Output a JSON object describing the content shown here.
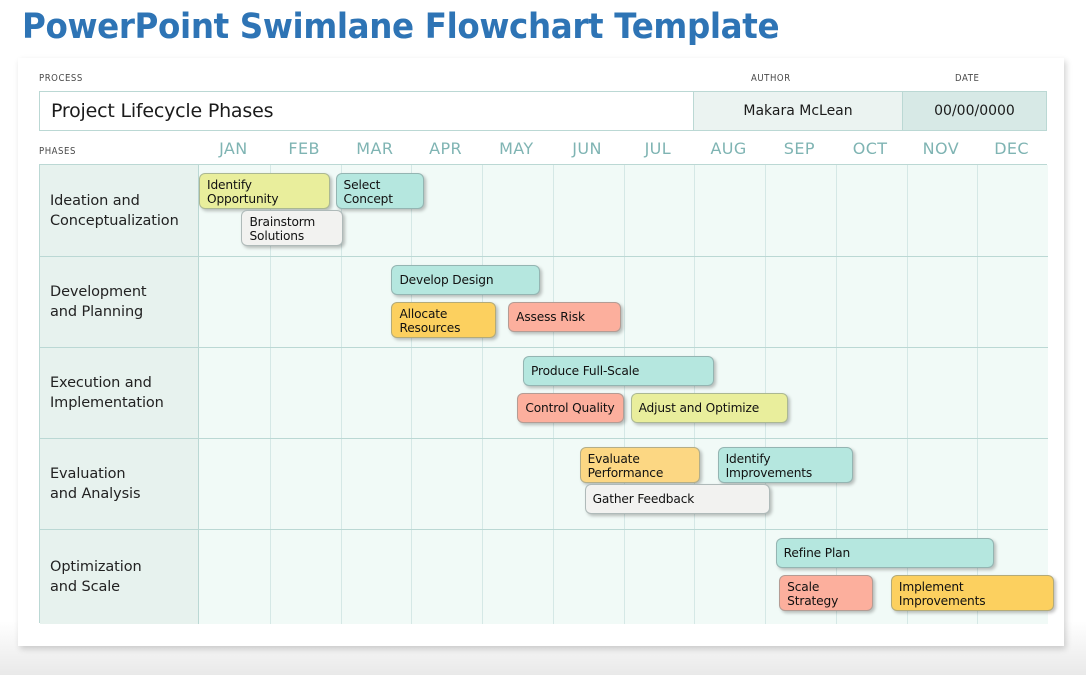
{
  "title": "PowerPoint Swimlane Flowchart Template",
  "header": {
    "process_label": "PROCESS",
    "author_label": "AUTHOR",
    "date_label": "DATE",
    "process_value": "Project Lifecycle Phases",
    "author_value": "Makara McLean",
    "date_value": "00/00/0000"
  },
  "timeline": {
    "phases_caption": "PHASES",
    "months": [
      "JAN",
      "FEB",
      "MAR",
      "APR",
      "MAY",
      "JUN",
      "JUL",
      "AUG",
      "SEP",
      "OCT",
      "NOV",
      "DEC"
    ]
  },
  "colors": {
    "title": "#2E74B5",
    "grid_line": "#BBD8D4",
    "lane_name_bg": "#E7F2EE",
    "track_bg": "#F1FAF7",
    "month_text": "#7FB4B3",
    "date_cell_bg": "#D7E9E6",
    "author_cell_bg": "#EBF3F1",
    "task_yellow": "#E9EE9C",
    "task_teal": "#B5E7DF",
    "task_white": "#F2F2F0",
    "task_amber": "#FCD05F",
    "task_amber_light": "#FCD783",
    "task_salmon": "#FCAF9D"
  },
  "lanes": [
    {
      "name": "Ideation and\nConceptualization",
      "tasks": [
        {
          "label": "Identify\nOpportunity",
          "color": "#E9EE9C",
          "start": 0.0,
          "span": 1.85,
          "row": 0,
          "align": "top"
        },
        {
          "label": "Select\nConcept",
          "color": "#B5E7DF",
          "start": 1.93,
          "span": 1.25,
          "row": 0,
          "align": "top"
        },
        {
          "label": "Brainstorm\nSolutions",
          "color": "#F2F2F0",
          "start": 0.6,
          "span": 1.43,
          "row": 1,
          "align": "top"
        }
      ]
    },
    {
      "name": "Development\nand Planning",
      "tasks": [
        {
          "label": "Develop Design",
          "color": "#B5E7DF",
          "start": 2.72,
          "span": 2.1,
          "row": 0,
          "align": "mid"
        },
        {
          "label": "Allocate\nResources",
          "color": "#FCD05F",
          "start": 2.72,
          "span": 1.48,
          "row": 1,
          "align": "top"
        },
        {
          "label": "Assess Risk",
          "color": "#FCAF9D",
          "start": 4.37,
          "span": 1.6,
          "row": 1,
          "align": "mid"
        }
      ]
    },
    {
      "name": "Execution and\nImplementation",
      "tasks": [
        {
          "label": "Produce Full-Scale",
          "color": "#B5E7DF",
          "start": 4.58,
          "span": 2.7,
          "row": 0,
          "align": "mid"
        },
        {
          "label": "Control Quality",
          "color": "#FCAF9D",
          "start": 4.5,
          "span": 1.5,
          "row": 1,
          "align": "mid"
        },
        {
          "label": "Adjust and Optimize",
          "color": "#E9EE9C",
          "start": 6.1,
          "span": 2.23,
          "row": 1,
          "align": "mid"
        }
      ]
    },
    {
      "name": "Evaluation\nand Analysis",
      "tasks": [
        {
          "label": "Evaluate\nPerformance",
          "color": "#FCD783",
          "start": 5.38,
          "span": 1.7,
          "row": 0,
          "align": "top"
        },
        {
          "label": "Identify\nImprovements",
          "color": "#B5E7DF",
          "start": 7.33,
          "span": 1.92,
          "row": 0,
          "align": "top"
        },
        {
          "label": "Gather Feedback",
          "color": "#F2F2F0",
          "start": 5.45,
          "span": 2.62,
          "row": 1,
          "align": "mid"
        }
      ]
    },
    {
      "name": "Optimization\nand Scale",
      "tasks": [
        {
          "label": "Refine Plan",
          "color": "#B5E7DF",
          "start": 8.15,
          "span": 3.08,
          "row": 0,
          "align": "mid"
        },
        {
          "label": "Scale\nStrategy",
          "color": "#FCAF9D",
          "start": 8.2,
          "span": 1.33,
          "row": 1,
          "align": "top"
        },
        {
          "label": "Implement\nImprovements",
          "color": "#FCD05F",
          "start": 9.78,
          "span": 2.3,
          "row": 1,
          "align": "top"
        }
      ]
    }
  ]
}
